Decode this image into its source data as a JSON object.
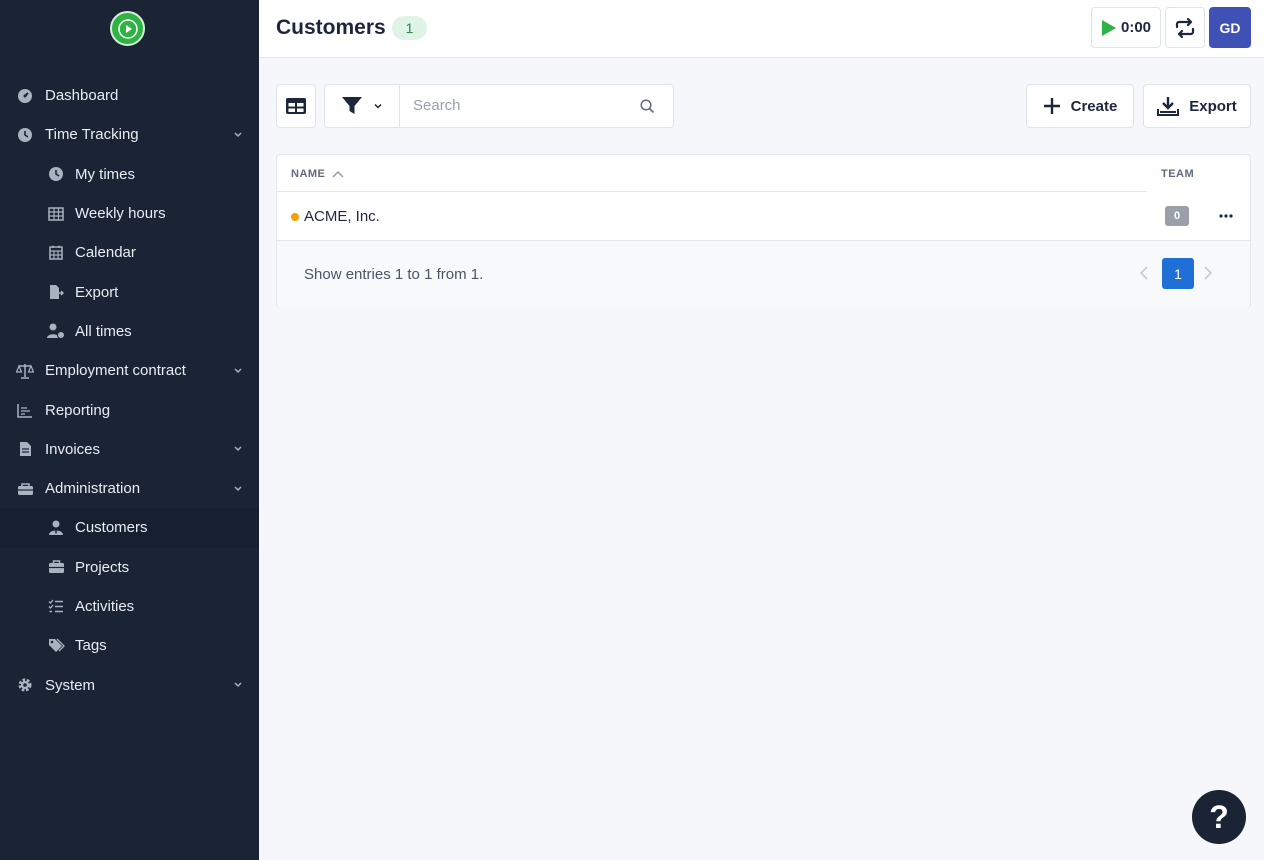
{
  "sidebar": {
    "items": [
      {
        "label": "Dashboard",
        "icon": "dashboard-icon"
      },
      {
        "label": "Time Tracking",
        "icon": "clock-icon",
        "expandable": true
      },
      {
        "label": "My times",
        "icon": "clock-icon",
        "sub": true
      },
      {
        "label": "Weekly hours",
        "icon": "table-grid-icon",
        "sub": true
      },
      {
        "label": "Calendar",
        "icon": "calendar-icon",
        "sub": true
      },
      {
        "label": "Export",
        "icon": "file-export-icon",
        "sub": true
      },
      {
        "label": "All times",
        "icon": "user-clock-icon",
        "sub": true
      },
      {
        "label": "Employment contract",
        "icon": "scale-icon",
        "expandable": true
      },
      {
        "label": "Reporting",
        "icon": "chart-line-icon"
      },
      {
        "label": "Invoices",
        "icon": "invoice-icon",
        "expandable": true
      },
      {
        "label": "Administration",
        "icon": "toolbox-icon",
        "expandable": true
      },
      {
        "label": "Customers",
        "icon": "user-tie-icon",
        "sub": true,
        "active": true
      },
      {
        "label": "Projects",
        "icon": "briefcase-icon",
        "sub": true
      },
      {
        "label": "Activities",
        "icon": "list-check-icon",
        "sub": true
      },
      {
        "label": "Tags",
        "icon": "tags-icon",
        "sub": true
      },
      {
        "label": "System",
        "icon": "gear-icon",
        "expandable": true
      }
    ]
  },
  "header": {
    "title": "Customers",
    "count": "1",
    "timer": "0:00",
    "avatar_initials": "GD"
  },
  "toolbar": {
    "search_placeholder": "Search",
    "create_label": "Create",
    "export_label": "Export"
  },
  "table": {
    "columns": [
      "NAME",
      "TEAM"
    ],
    "rows": [
      {
        "name": "ACME, Inc.",
        "team": "0",
        "color": "#f59f00"
      }
    ],
    "footer_text": "Show entries 1 to 1 from 1.",
    "current_page": "1"
  },
  "help_label": "?",
  "colors": {
    "sidebar_bg": "#1b2434",
    "accent_green": "#2fb344",
    "avatar_bg": "#3f51b5",
    "page_active": "#1f6fd6"
  }
}
